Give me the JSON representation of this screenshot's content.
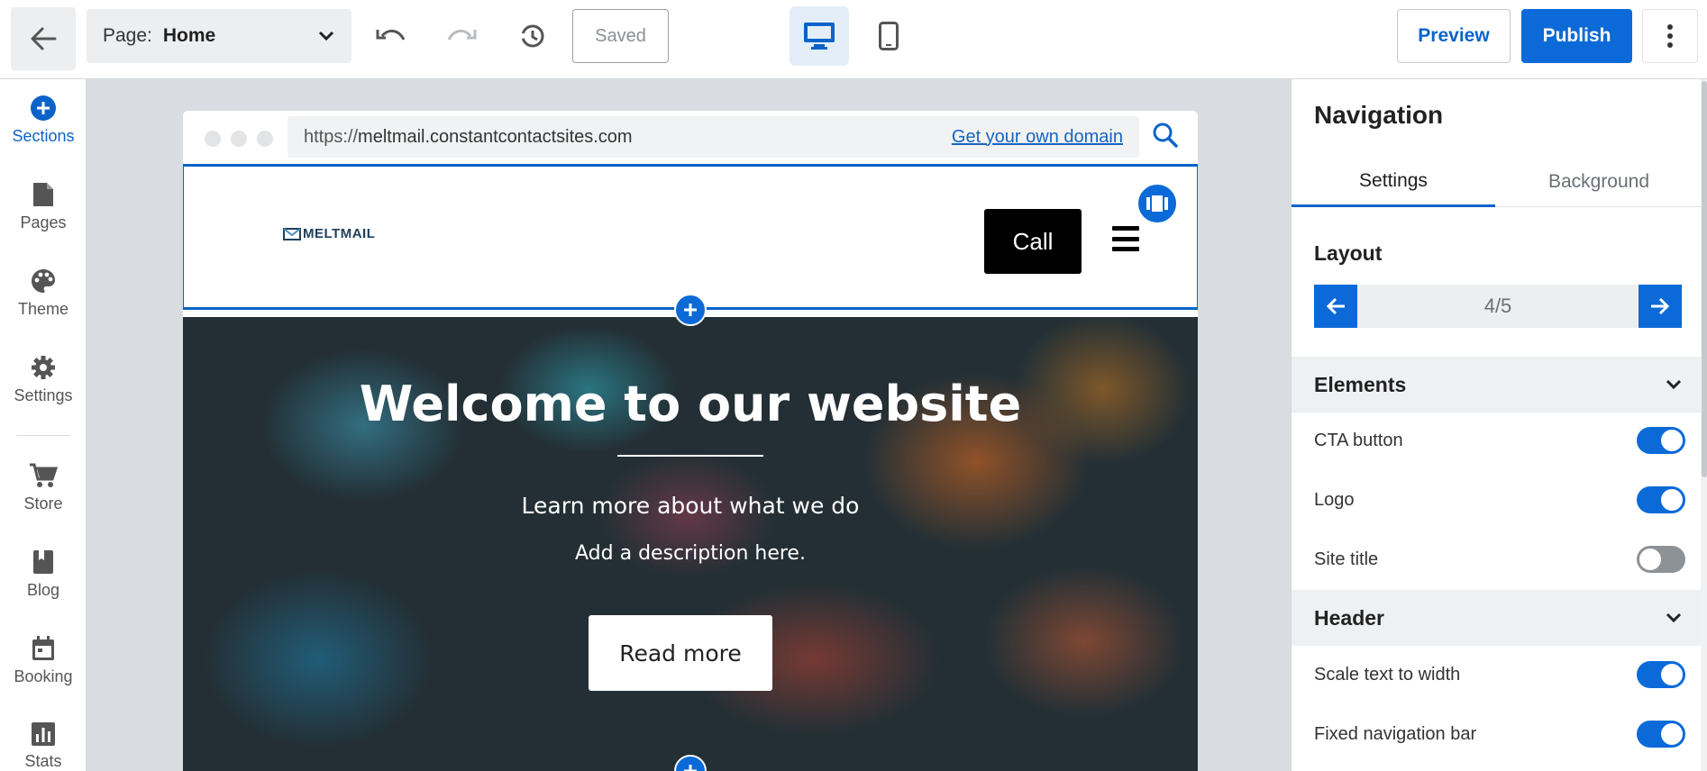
{
  "toolbar": {
    "page_label": "Page:",
    "page_value": "Home",
    "saved_label": "Saved",
    "preview_label": "Preview",
    "publish_label": "Publish",
    "icons": [
      "back-arrow-icon",
      "chevron-down-icon",
      "undo-icon",
      "redo-icon",
      "history-icon",
      "desktop-icon",
      "mobile-icon",
      "more-vertical-icon"
    ],
    "accent_color": "#0b6ad8"
  },
  "sidebar": {
    "items": [
      {
        "label": "Sections",
        "icon": "plus-circle-icon",
        "active": true
      },
      {
        "label": "Pages",
        "icon": "page-icon"
      },
      {
        "label": "Theme",
        "icon": "palette-icon"
      },
      {
        "label": "Settings",
        "icon": "gear-icon"
      },
      {
        "label": "Store",
        "icon": "cart-icon"
      },
      {
        "label": "Blog",
        "icon": "book-icon"
      },
      {
        "label": "Booking",
        "icon": "calendar-icon"
      },
      {
        "label": "Stats",
        "icon": "bar-chart-icon"
      }
    ]
  },
  "canvas": {
    "url_prefix": "https://",
    "url_domain": "meltmail.constantcontactsites.com",
    "domain_link": "Get your own domain",
    "logo_text": "MELTMAIL",
    "call_label": "Call",
    "hero_title": "Welcome to our website",
    "hero_subtitle": "Learn more about what we do",
    "hero_description": "Add a description here.",
    "readmore_label": "Read more"
  },
  "panel": {
    "title": "Navigation",
    "tabs": [
      "Settings",
      "Background"
    ],
    "active_tab": "Settings",
    "layout_label": "Layout",
    "layout_value": "4/5",
    "elements": {
      "title": "Elements",
      "toggles": [
        {
          "label": "CTA button",
          "on": true
        },
        {
          "label": "Logo",
          "on": true
        },
        {
          "label": "Site title",
          "on": false
        }
      ]
    },
    "header": {
      "title": "Header",
      "toggles": [
        {
          "label": "Scale text to width",
          "on": true
        },
        {
          "label": "Fixed navigation bar",
          "on": true
        }
      ]
    }
  }
}
